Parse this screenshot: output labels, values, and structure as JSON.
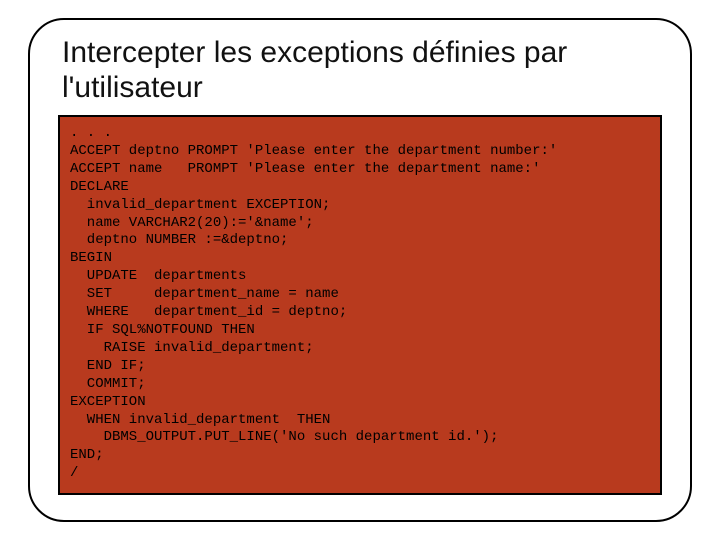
{
  "slide": {
    "title": "Intercepter les exceptions définies par l'utilisateur",
    "code_lines": [
      ". . .",
      "ACCEPT deptno PROMPT 'Please enter the department number:'",
      "ACCEPT name   PROMPT 'Please enter the department name:'",
      "DECLARE",
      "  invalid_department EXCEPTION;",
      "  name VARCHAR2(20):='&name';",
      "  deptno NUMBER :=&deptno;",
      "BEGIN",
      "  UPDATE  departments",
      "  SET     department_name = name",
      "  WHERE   department_id = deptno;",
      "  IF SQL%NOTFOUND THEN",
      "    RAISE invalid_department;",
      "  END IF;",
      "  COMMIT;",
      "EXCEPTION",
      "  WHEN invalid_department  THEN",
      "    DBMS_OUTPUT.PUT_LINE('No such department id.');",
      "END;",
      "/"
    ]
  }
}
